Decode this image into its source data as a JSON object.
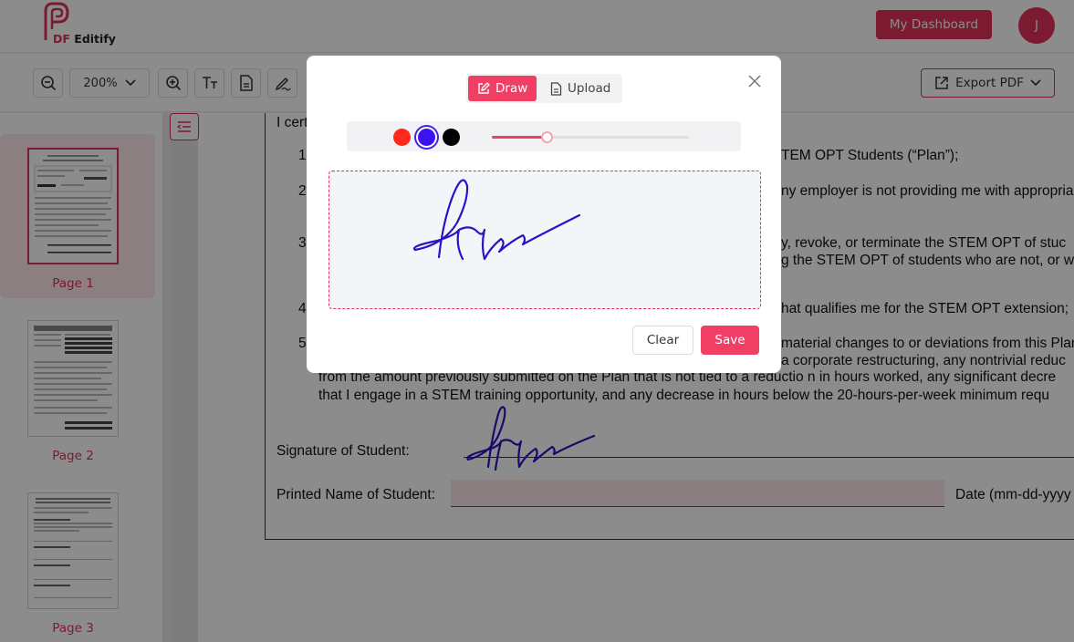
{
  "app": {
    "logo_prefix": "DF",
    "logo_name": "Editify",
    "logo_icon": "pdf-p-logo"
  },
  "header": {
    "dashboard_label": "My Dashboard",
    "avatar_initial": "J"
  },
  "toolbar": {
    "zoom_out_icon": "zoom-out-icon",
    "zoom_value": "200%",
    "zoom_in_icon": "zoom-in-icon",
    "text_tool_icon": "text-size-icon",
    "page_tool_icon": "document-icon",
    "sign_tool_icon": "pen-signature-icon",
    "export_label": "Export PDF"
  },
  "sidebar": {
    "pages": [
      {
        "label": "Page 1",
        "active": true
      },
      {
        "label": "Page 2",
        "active": false
      },
      {
        "label": "Page 3",
        "active": false
      }
    ]
  },
  "document": {
    "lines": [
      {
        "text": "I cert"
      },
      {
        "text": "1"
      },
      {
        "text": "TEM OPT Students (“Plan”);"
      },
      {
        "text": "2"
      },
      {
        "text": "ny employer is not providing me with appropria"
      },
      {
        "text": "3"
      },
      {
        "text": "y, revoke, or terminate the STEM OPT of stuc"
      },
      {
        "text": "g the STEM OPT of students who are not, or w"
      },
      {
        "text": "4"
      },
      {
        "text": "hat qualifies me for the STEM OPT extension;"
      },
      {
        "text": "5"
      },
      {
        "text": "material changes to or deviations from this Plan"
      },
      {
        "text": "a corporate restructuring, any nontrivial reduc"
      },
      {
        "text": "from the amount previously submitted on the Plan that is not tied to a reductio n in hours worked, any significant decre"
      },
      {
        "text": "that I engage in a STEM training opportunity, and any decrease in hours below the 20-hours-per-week minimum requ"
      }
    ],
    "signature_label": "Signature of Student:",
    "printed_name_label": "Printed Name of Student:",
    "printed_name_value": "",
    "date_label": "Date (mm-dd-yyyy"
  },
  "modal": {
    "tabs": [
      {
        "label": "Draw",
        "icon": "edit-icon",
        "active": true
      },
      {
        "label": "Upload",
        "icon": "file-icon",
        "active": false
      }
    ],
    "colors": [
      {
        "name": "red",
        "hex": "#ff2a1a",
        "selected": false
      },
      {
        "name": "blue",
        "hex": "#3b12f0",
        "selected": true
      },
      {
        "name": "black",
        "hex": "#000000",
        "selected": false
      }
    ],
    "stroke_width_fraction": 0.28,
    "clear_label": "Clear",
    "save_label": "Save"
  },
  "colors": {
    "accent": "#e0315a",
    "ink": "#1a10c8"
  }
}
